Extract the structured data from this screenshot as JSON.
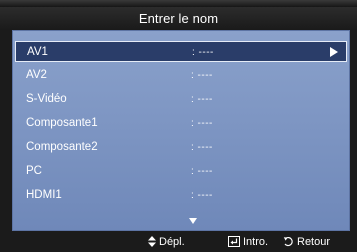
{
  "title": "Entrer le nom",
  "rows": [
    {
      "name": "AV1",
      "value": ": ----"
    },
    {
      "name": "AV2",
      "value": ": ----"
    },
    {
      "name": "S-Vidéo",
      "value": ": ----"
    },
    {
      "name": "Composante1",
      "value": ": ----"
    },
    {
      "name": "Composante2",
      "value": ": ----"
    },
    {
      "name": "PC",
      "value": ": ----"
    },
    {
      "name": "HDMI1",
      "value": ": ----"
    }
  ],
  "footer": {
    "move_label": "Dépl.",
    "enter_label": "Intro.",
    "return_label": "Retour",
    "move_icon": "up-down-arrows-icon",
    "enter_icon": "enter-key-icon",
    "return_icon": "return-arrow-icon"
  },
  "colors": {
    "panel": "#7e96c2",
    "selected_row": "#2a3d69",
    "background": "#1b1b1b"
  }
}
